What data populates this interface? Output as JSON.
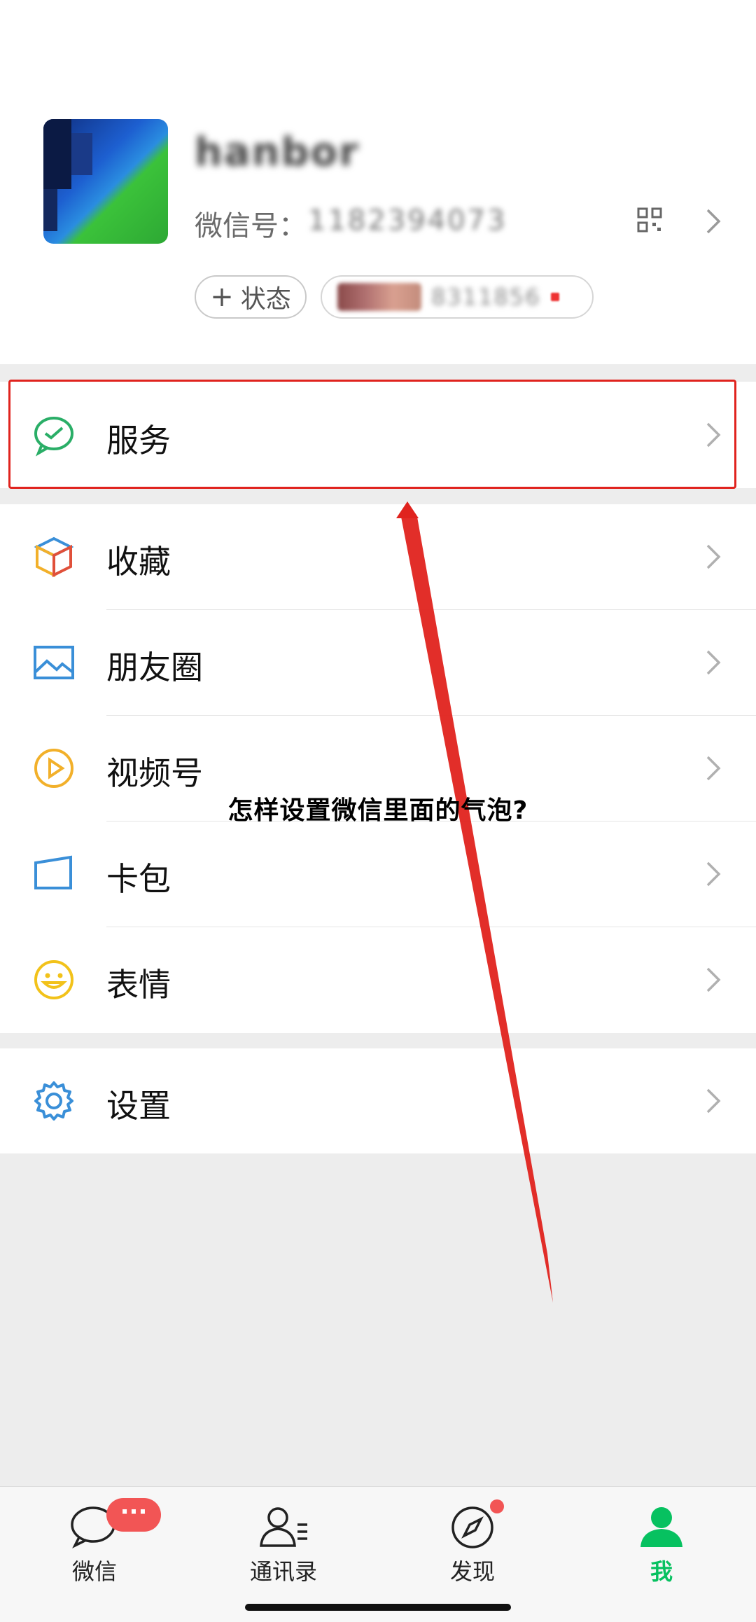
{
  "profile": {
    "nickname": "hanbor",
    "wechat_id_label": "微信号：",
    "wechat_id_value": "1182394073",
    "status_button": "状态",
    "friend_status_text": "8311856"
  },
  "menu": {
    "services": "服务",
    "favorites": "收藏",
    "moments": "朋友圈",
    "channels": "视频号",
    "cards": "卡包",
    "stickers": "表情",
    "settings": "设置"
  },
  "overlay_caption": "怎样设置微信里面的气泡?",
  "tabs": [
    {
      "label": "微信",
      "badge": "···"
    },
    {
      "label": "通讯录"
    },
    {
      "label": "发现"
    },
    {
      "label": "我"
    }
  ],
  "colors": {
    "accent": "#07c160",
    "highlight_box": "#e0231e",
    "badge": "#f25555"
  }
}
